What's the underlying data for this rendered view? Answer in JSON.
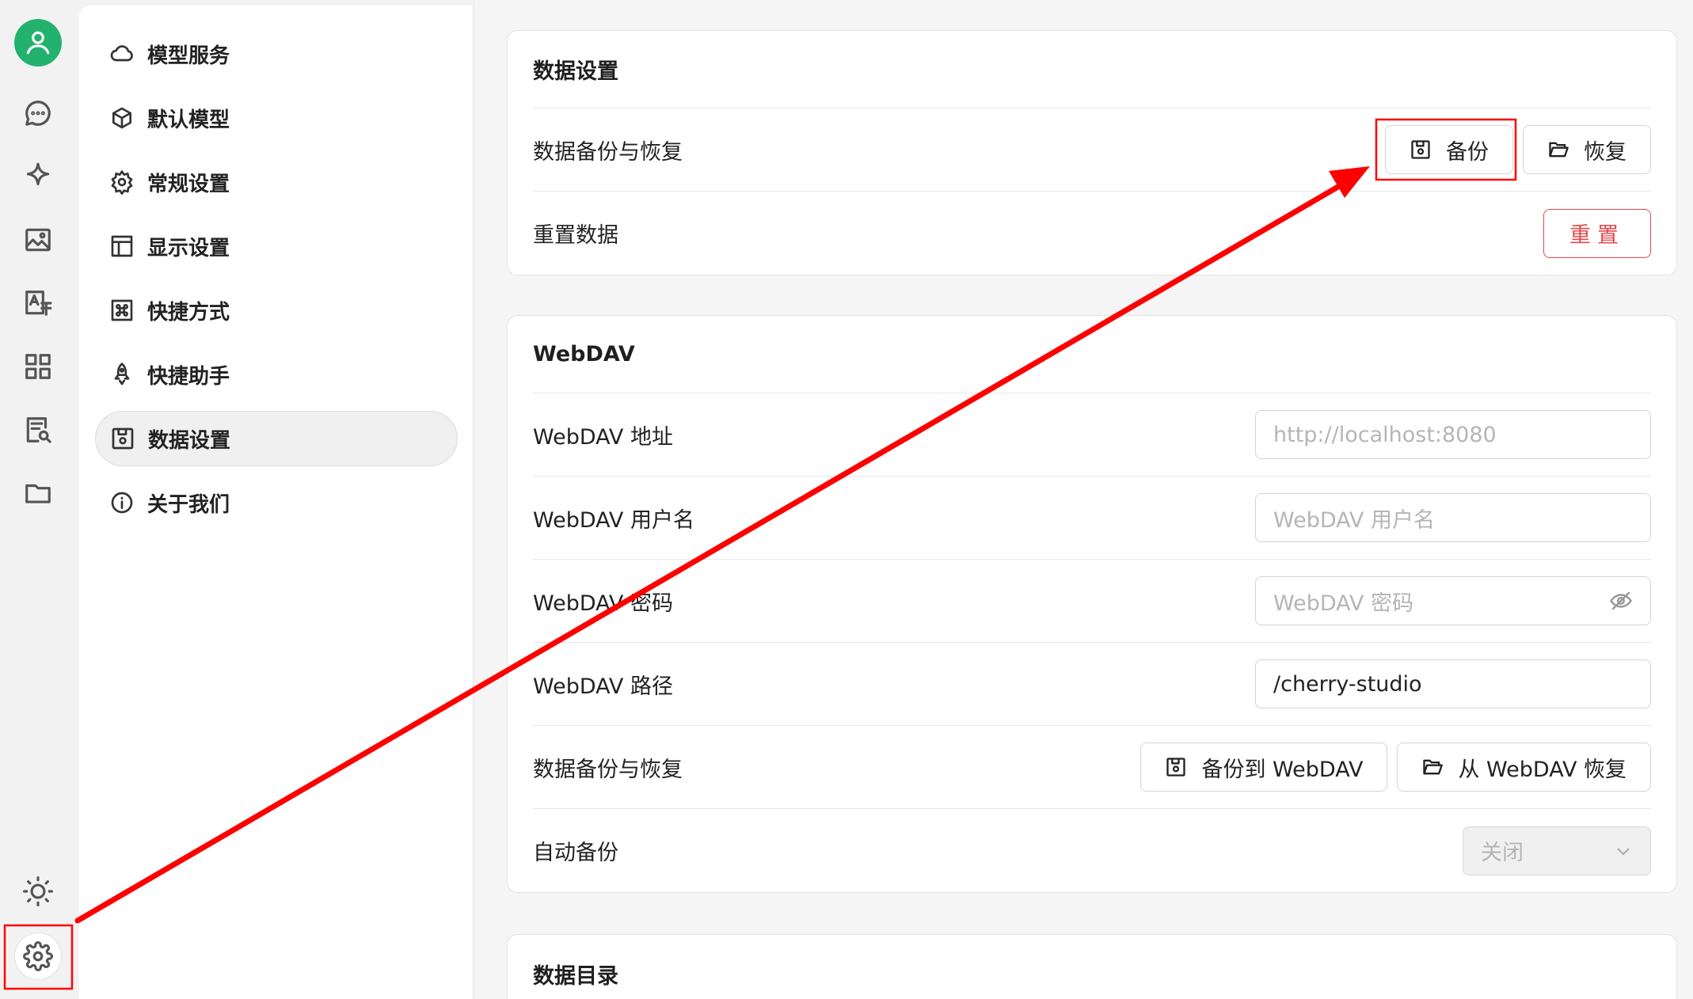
{
  "rail": {
    "items": [
      {
        "icon": "user-avatar-icon"
      },
      {
        "icon": "chat-bubble-icon"
      },
      {
        "icon": "sparkle-icon"
      },
      {
        "icon": "image-icon"
      },
      {
        "icon": "translate-icon"
      },
      {
        "icon": "apps-grid-icon"
      },
      {
        "icon": "document-search-icon"
      },
      {
        "icon": "folder-icon"
      },
      {
        "icon": "sun-icon"
      },
      {
        "icon": "gear-icon"
      }
    ]
  },
  "sidebar": {
    "items": [
      {
        "label": "模型服务",
        "icon": "cloud-icon"
      },
      {
        "label": "默认模型",
        "icon": "cube-icon"
      },
      {
        "label": "常规设置",
        "icon": "gear-icon"
      },
      {
        "label": "显示设置",
        "icon": "layout-icon"
      },
      {
        "label": "快捷方式",
        "icon": "command-icon"
      },
      {
        "label": "快捷助手",
        "icon": "rocket-icon"
      },
      {
        "label": "数据设置",
        "icon": "save-icon",
        "active": true
      },
      {
        "label": "关于我们",
        "icon": "info-icon"
      }
    ]
  },
  "data_settings": {
    "title": "数据设置",
    "backup_label": "数据备份与恢复",
    "backup_button": "备份",
    "restore_button": "恢复",
    "reset_label": "重置数据",
    "reset_button": "重置"
  },
  "webdav": {
    "title": "WebDAV",
    "url_label": "WebDAV 地址",
    "url_placeholder": "http://localhost:8080",
    "user_label": "WebDAV 用户名",
    "user_placeholder": "WebDAV 用户名",
    "password_label": "WebDAV 密码",
    "password_placeholder": "WebDAV 密码",
    "path_label": "WebDAV 路径",
    "path_value": "/cherry-studio",
    "backup_label": "数据备份与恢复",
    "backup_button": "备份到 WebDAV",
    "restore_button": "从 WebDAV 恢复",
    "auto_label": "自动备份",
    "auto_value": "关闭"
  },
  "data_dir": {
    "title": "数据目录"
  },
  "colors": {
    "accent_green": "#23b26d",
    "annotation_red": "#ff0000",
    "danger": "#e5484d"
  }
}
